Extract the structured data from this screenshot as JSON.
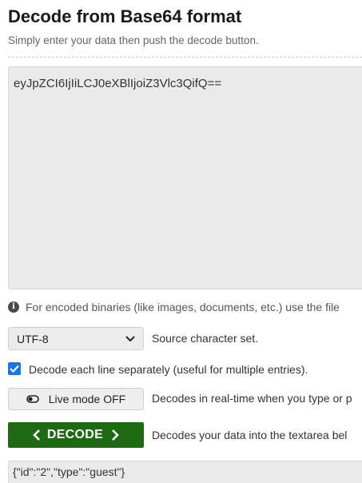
{
  "header": {
    "title": "Decode from Base64 format",
    "subtitle": "Simply enter your data then push the decode button."
  },
  "input": {
    "value": "eyJpZCI6IjIiLCJ0eXBlIjoiZ3Vlc3QifQ=="
  },
  "info": {
    "icon": "info-icon",
    "text": "For encoded binaries (like images, documents, etc.) use the file"
  },
  "charset": {
    "selected": "UTF-8",
    "label": "Source character set."
  },
  "each_line": {
    "checked": true,
    "label": "Decode each line separately (useful for multiple entries)."
  },
  "live_mode": {
    "button_label": "Live mode OFF",
    "description": "Decodes in real-time when you type or p"
  },
  "decode": {
    "button_label": "DECODE",
    "description": "Decodes your data into the textarea bel"
  },
  "output": {
    "value": "{\"id\":\"2\",\"type\":\"guest\"}"
  },
  "colors": {
    "decode_button": "#1e6a13",
    "checkbox": "#1a73e8",
    "textarea_bg": "#eaeaea"
  }
}
